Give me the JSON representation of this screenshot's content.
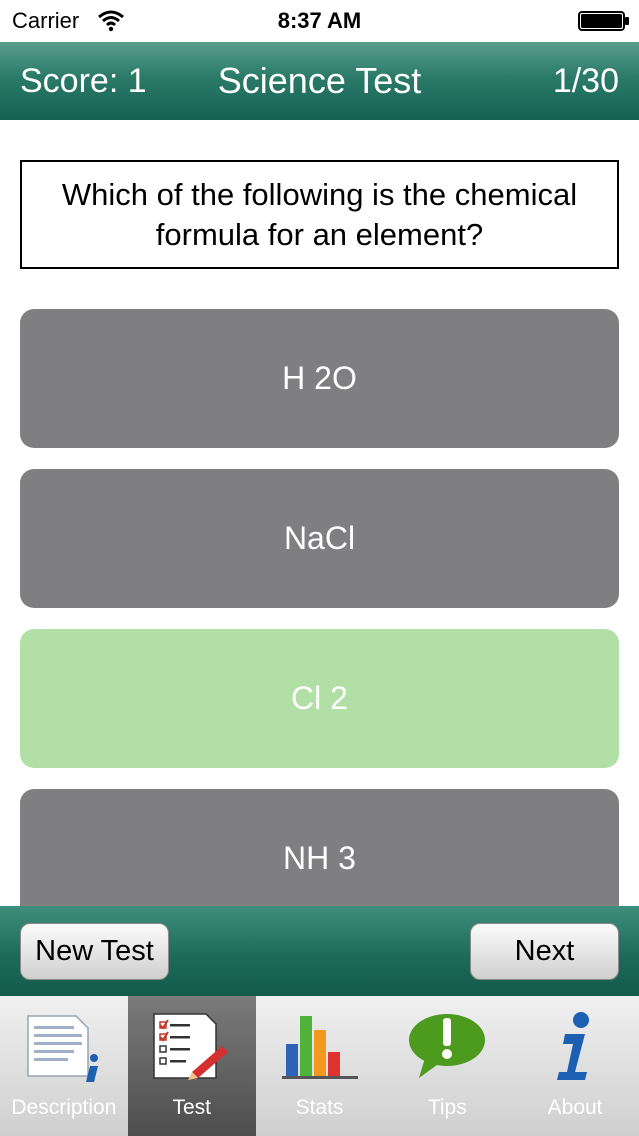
{
  "status_bar": {
    "carrier": "Carrier",
    "time": "8:37 AM"
  },
  "header": {
    "score": "Score: 1",
    "title": "Science Test",
    "progress": "1/30"
  },
  "question": "Which of the following is the chemical formula for an element?",
  "answers": [
    {
      "label": "H 2O",
      "state": "default"
    },
    {
      "label": "NaCl",
      "state": "default"
    },
    {
      "label": "Cl 2",
      "state": "correct"
    },
    {
      "label": "NH 3",
      "state": "default"
    }
  ],
  "actions": {
    "new_test": "New Test",
    "next": "Next"
  },
  "tabs": [
    {
      "label": "Description",
      "icon": "document-info-icon",
      "active": false
    },
    {
      "label": "Test",
      "icon": "checklist-pencil-icon",
      "active": true
    },
    {
      "label": "Stats",
      "icon": "bar-chart-icon",
      "active": false
    },
    {
      "label": "Tips",
      "icon": "exclamation-bubble-icon",
      "active": false
    },
    {
      "label": "About",
      "icon": "info-icon",
      "active": false
    }
  ],
  "colors": {
    "header_green": "#2b7a68",
    "answer_gray": "#7f7e80",
    "answer_correct": "#b2dfa6",
    "tab_active": "#5a5a5a"
  }
}
